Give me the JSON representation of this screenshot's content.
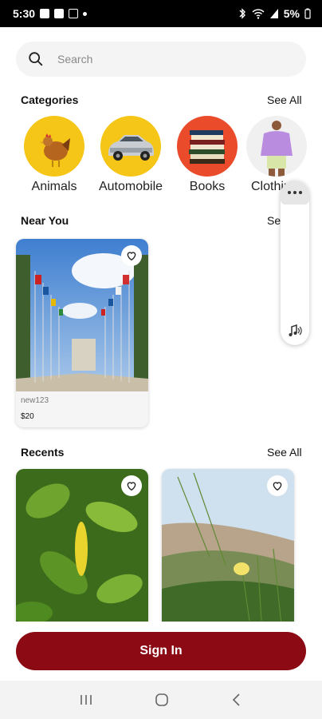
{
  "status": {
    "time": "5:30",
    "battery": "5%"
  },
  "search": {
    "placeholder": "Search"
  },
  "categories": {
    "title": "Categories",
    "see_all": "See All",
    "items": [
      {
        "label": "Animals",
        "bg": "#f5c518"
      },
      {
        "label": "Automobile",
        "bg": "#f5c518"
      },
      {
        "label": "Books",
        "bg": "#ea4c2b"
      },
      {
        "label": "Clothing",
        "bg": "#f0f0f0"
      }
    ]
  },
  "near_you": {
    "title": "Near You",
    "see_all": "See All",
    "items": [
      {
        "name": "new123",
        "price": "$20"
      }
    ]
  },
  "recents": {
    "title": "Recents",
    "see_all": "See All"
  },
  "actions": {
    "sign_in": "Sign In"
  },
  "colors": {
    "accent": "#8b0a14"
  }
}
